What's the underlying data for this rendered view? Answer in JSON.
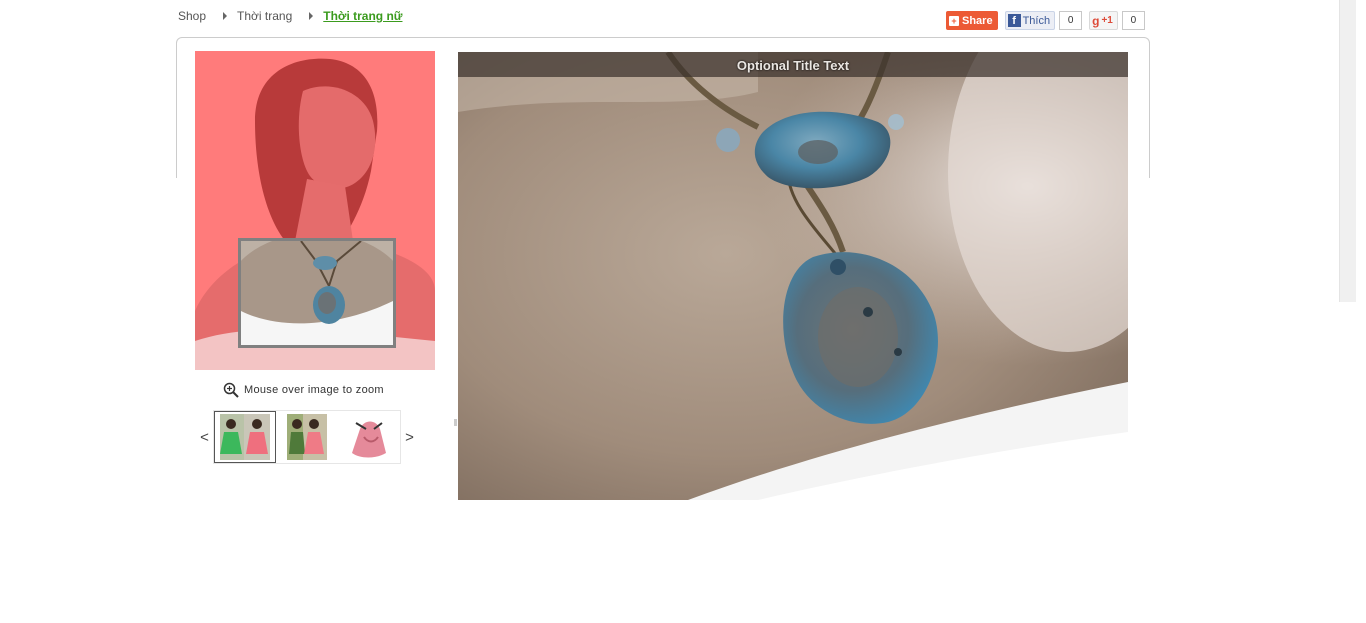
{
  "breadcrumb": {
    "items": [
      "Shop",
      "Thời trang"
    ],
    "active": "Thời trang nữ"
  },
  "social": {
    "share_label": "Share",
    "facebook_label": "Thích",
    "facebook_count": "0",
    "gplus_label": "+1",
    "gplus_count": "0"
  },
  "product": {
    "zoom_hint": "Mouse over image to zoom",
    "prev_label": "<",
    "next_label": ">",
    "thumbnails": [
      "thumb-1",
      "thumb-2",
      "thumb-3"
    ],
    "selected_thumbnail": 0
  },
  "zoom": {
    "title": "Optional Title Text"
  },
  "colors": {
    "breadcrumb_active": "#3b9b1e",
    "share": "#ec5a35",
    "facebook": "#3b5998",
    "gplus": "#dd4b39",
    "image_tint": "#ff6464"
  }
}
